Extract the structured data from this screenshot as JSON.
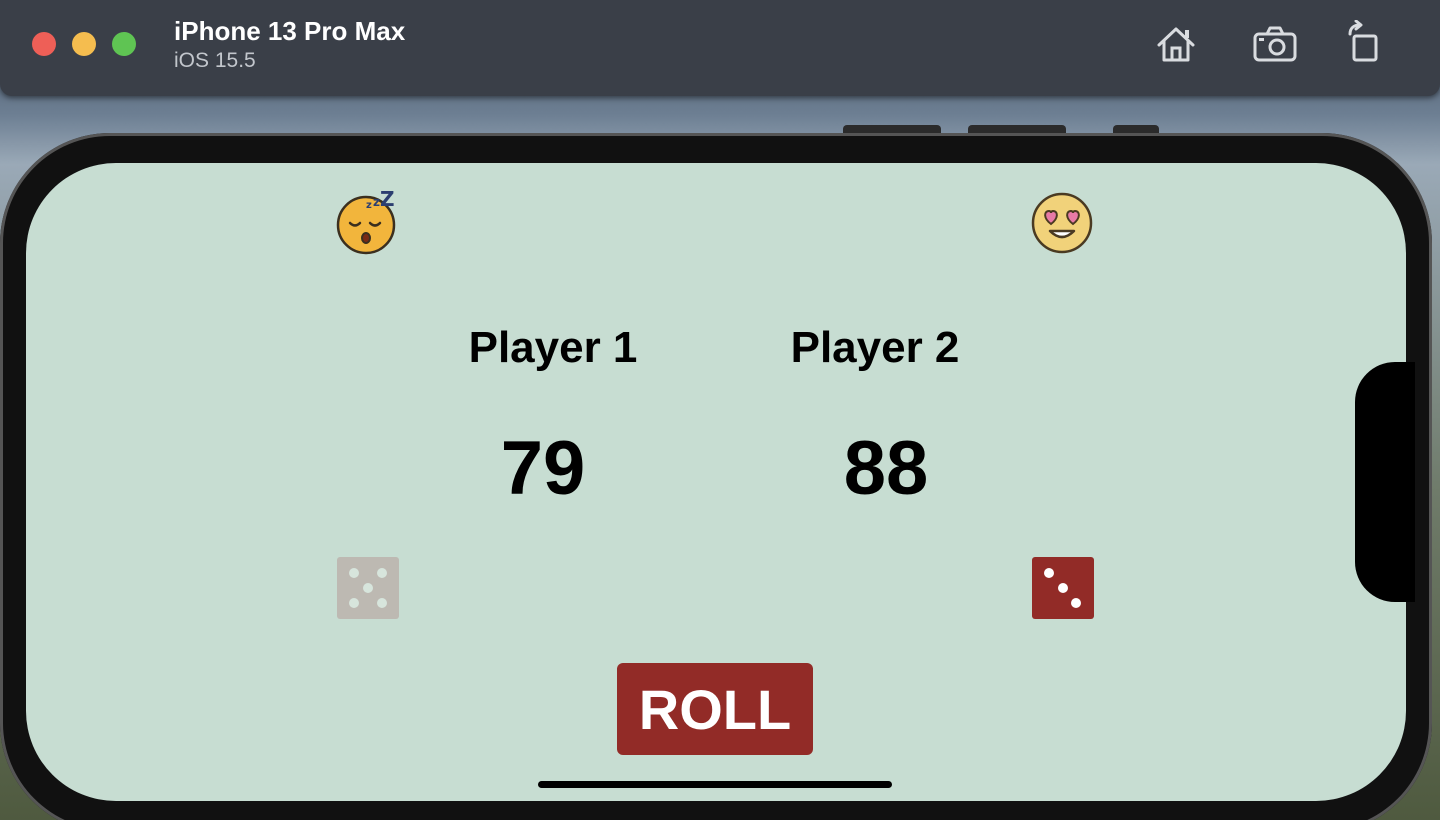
{
  "simulator": {
    "device_name": "iPhone 13 Pro Max",
    "os_version": "iOS 15.5",
    "toolbar_icons": [
      "home-icon",
      "screenshot-icon",
      "rotate-icon"
    ],
    "window_controls": [
      "close",
      "minimize",
      "zoom"
    ]
  },
  "app": {
    "background_color": "#c7ddd2",
    "players": [
      {
        "label": "Player 1",
        "score": "79",
        "emoji": "sleeping-face-icon",
        "die_face": 5,
        "die_color": "#bdb9b2",
        "active": false
      },
      {
        "label": "Player 2",
        "score": "88",
        "emoji": "heart-eyes-face-icon",
        "die_face": 3,
        "die_color": "#922b27",
        "active": true
      }
    ],
    "roll_button": {
      "label": "ROLL",
      "color": "#922b27"
    }
  }
}
